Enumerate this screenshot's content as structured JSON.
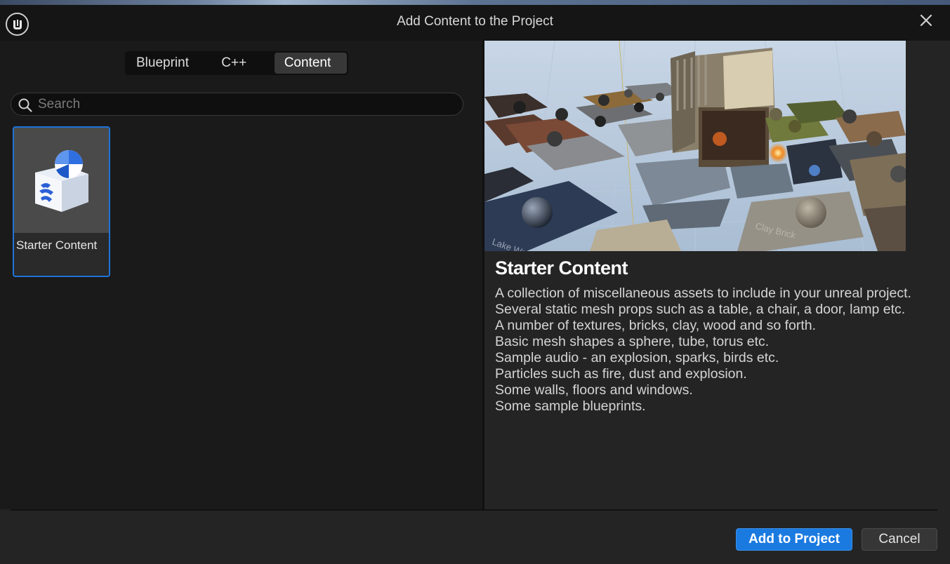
{
  "window": {
    "title": "Add Content to the Project"
  },
  "tabs": [
    {
      "label": "Blueprint",
      "active": false
    },
    {
      "label": "C++",
      "active": false
    },
    {
      "label": "Content",
      "active": true
    }
  ],
  "search": {
    "placeholder": "Search",
    "value": ""
  },
  "content_items": [
    {
      "label": "Starter Content",
      "selected": true,
      "icon": "starter-content-icon"
    }
  ],
  "details": {
    "title": "Starter Content",
    "preview_labels": [
      "Lake Water",
      "Clay Brick"
    ],
    "lines": [
      "A collection of miscellaneous assets to include in your unreal project.",
      "Several static mesh props such as a table, a chair, a door, lamp etc.",
      "A number of textures, bricks, clay, wood and so forth.",
      "Basic mesh shapes a sphere, tube, torus etc.",
      "Sample audio - an explosion, sparks, birds etc.",
      "Particles such as fire, dust and explosion.",
      "Some walls, floors and windows.",
      "Some sample blueprints."
    ]
  },
  "footer": {
    "add_label": "Add to Project",
    "cancel_label": "Cancel"
  },
  "colors": {
    "accent": "#1a7ae0",
    "selection_border": "#1e73d8",
    "background": "#242424"
  }
}
